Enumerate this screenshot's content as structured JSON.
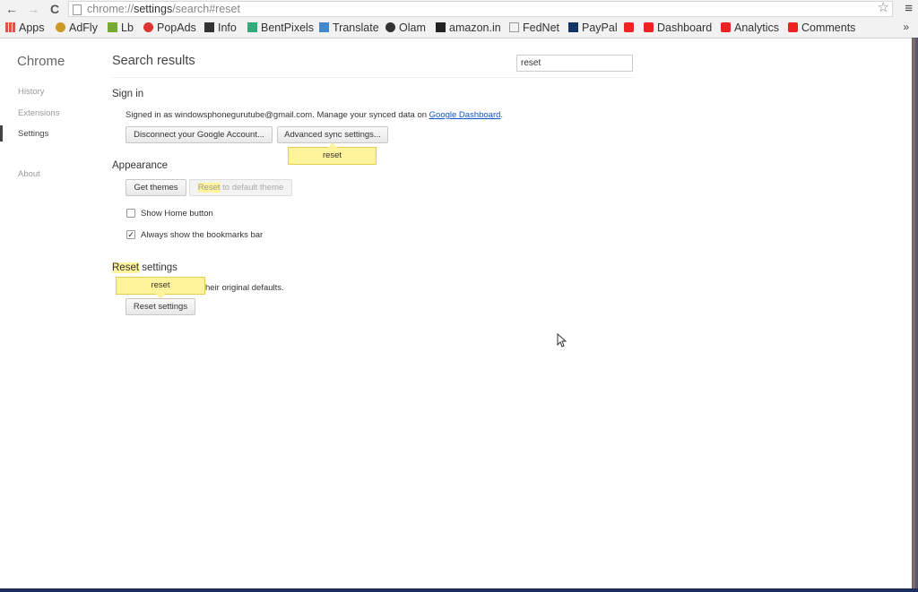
{
  "browser": {
    "url_prefix": "chrome://",
    "url_bold": "settings",
    "url_suffix": "/search#reset",
    "back_icon": "←",
    "forward_icon": "→",
    "reload_icon": "C",
    "star_icon": "☆",
    "menu_icon": "≡"
  },
  "bookmarks": {
    "items": [
      {
        "label": "Apps",
        "icon": "apps-grid-icon",
        "color": "#d54"
      },
      {
        "label": "AdFly",
        "icon": "adfly-icon",
        "color": "#c92"
      },
      {
        "label": "Lb",
        "icon": "lb-icon",
        "color": "#7a3"
      },
      {
        "label": "PopAds",
        "icon": "popads-icon",
        "color": "#d33"
      },
      {
        "label": "Info",
        "icon": "linkedin-icon",
        "color": "#333"
      },
      {
        "label": "BentPixels",
        "icon": "bentpixels-icon",
        "color": "#3a7"
      },
      {
        "label": "Translate",
        "icon": "translate-icon",
        "color": "#48c"
      },
      {
        "label": "Olam",
        "icon": "olam-icon",
        "color": "#333"
      },
      {
        "label": "amazon.in",
        "icon": "amazon-icon",
        "color": "#222"
      },
      {
        "label": "FedNet",
        "icon": "page-icon",
        "color": "#999"
      },
      {
        "label": "PayPal",
        "icon": "paypal-icon",
        "color": "#136"
      },
      {
        "label": "",
        "icon": "youtube-icon",
        "color": "#e22"
      },
      {
        "label": "Dashboard",
        "icon": "youtube-icon",
        "color": "#e22"
      },
      {
        "label": "Analytics",
        "icon": "youtube-icon",
        "color": "#e22"
      },
      {
        "label": "Comments",
        "icon": "youtube-icon",
        "color": "#e22"
      }
    ],
    "more": "»"
  },
  "sidebar": {
    "brand": "Chrome",
    "items": [
      {
        "label": "History"
      },
      {
        "label": "Extensions"
      },
      {
        "label": "Settings"
      },
      {
        "label": "About"
      }
    ]
  },
  "main": {
    "title": "Search results",
    "search_value": "reset",
    "sign_in": {
      "heading": "Sign in",
      "text": "Signed in as windowsphonegurutube@gmail.com. Manage your synced data on ",
      "link": "Google Dashboard",
      "text_end": ".",
      "disconnect_button": "Disconnect your Google Account...",
      "advanced_button": "Advanced sync settings...",
      "bubble": "reset"
    },
    "appearance": {
      "heading": "Appearance",
      "themes_button": "Get themes",
      "reset_theme_hl": "Reset",
      "reset_theme_rest": " to default theme",
      "home_button_label": "Show Home button",
      "bookmarks_bar_label": "Always show the bookmarks bar"
    },
    "reset": {
      "heading_hl": "Reset",
      "heading_rest": " settings",
      "desc": "heir original defaults.",
      "bubble": "reset",
      "button": "Reset settings"
    }
  }
}
